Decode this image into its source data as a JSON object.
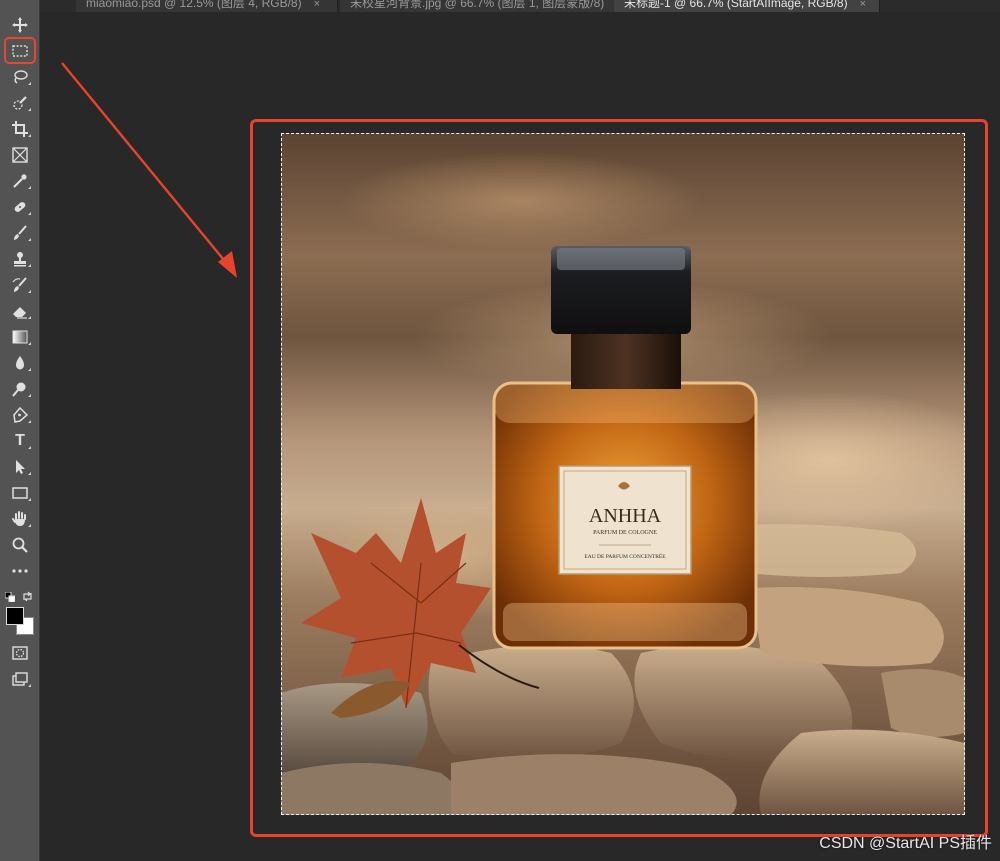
{
  "tabs": [
    {
      "label": "miaomiao.psd @ 12.5% (图层 4, RGB/8)",
      "active": false
    },
    {
      "label": "未校星河背景.jpg @ 66.7% (图层 1, 图层蒙版/8)",
      "active": false
    },
    {
      "label": "未标题-1 @ 66.7% (StartAIImage, RGB/8)",
      "active": true
    }
  ],
  "tab_close_glyph": "×",
  "toolbar": {
    "tools": [
      {
        "name": "move-icon"
      },
      {
        "name": "rectangular-marquee-icon",
        "selected": true
      },
      {
        "name": "lasso-icon"
      },
      {
        "name": "quick-selection-icon"
      },
      {
        "name": "crop-icon"
      },
      {
        "name": "frame-icon"
      },
      {
        "name": "eyedropper-icon"
      },
      {
        "name": "healing-brush-icon"
      },
      {
        "name": "brush-icon"
      },
      {
        "name": "clone-stamp-icon"
      },
      {
        "name": "history-brush-icon"
      },
      {
        "name": "eraser-icon"
      },
      {
        "name": "gradient-icon"
      },
      {
        "name": "blur-icon"
      },
      {
        "name": "dodge-icon"
      },
      {
        "name": "pen-icon"
      },
      {
        "name": "type-icon"
      },
      {
        "name": "path-selection-icon"
      },
      {
        "name": "rectangle-icon"
      },
      {
        "name": "hand-icon"
      },
      {
        "name": "zoom-icon"
      },
      {
        "name": "more-tools-icon"
      },
      {
        "name": "quick-mask-icon"
      },
      {
        "name": "screen-mode-icon"
      }
    ],
    "type_tool_glyph": "T",
    "foreground_color": "#000000",
    "background_color": "#ffffff"
  },
  "canvas": {
    "label_text": "ANHHA",
    "label_sub": "PARFUM DE COLOGNE",
    "label_bottom": "EAU DE PARFUM CONCENTRÉE"
  },
  "colors": {
    "annotation": "#e8432d",
    "toolbar_bg": "#535353",
    "workspace_bg": "#282828"
  },
  "watermark": "CSDN @StartAI PS插件"
}
